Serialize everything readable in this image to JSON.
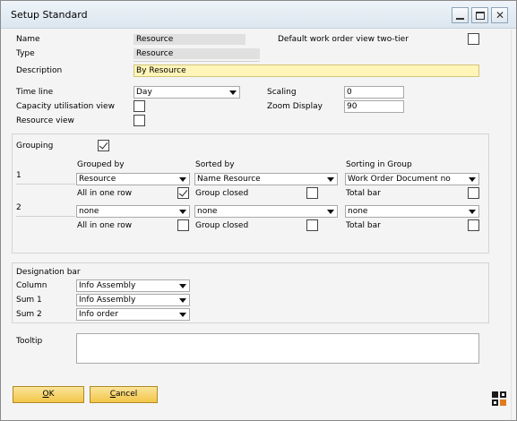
{
  "window": {
    "title": "Setup Standard",
    "controls": {
      "minimize": "minimize",
      "maximize": "maximize",
      "close": "✕"
    }
  },
  "header": {
    "name_label": "Name",
    "name_value": "Resource",
    "type_label": "Type",
    "type_value": "Resource",
    "description_label": "Description",
    "description_value": "By Resource",
    "two_tier_label": "Default work order view two-tier",
    "two_tier_checked": false
  },
  "view": {
    "time_line_label": "Time line",
    "time_line_value": "Day",
    "capacity_label": "Capacity utilisation view",
    "capacity_checked": false,
    "resource_view_label": "Resource view",
    "resource_view_checked": false,
    "scaling_label": "Scaling",
    "scaling_value": "0",
    "zoom_label": "Zoom Display",
    "zoom_value": "90"
  },
  "grouping": {
    "label": "Grouping",
    "checked": true,
    "col_grouped_by": "Grouped by",
    "col_sorted_by": "Sorted by",
    "col_sorting_in_group": "Sorting in Group",
    "rows": [
      {
        "index": "1",
        "grouped_by": "Resource",
        "sorted_by": "Name Resource",
        "sorting_in_group": "Work Order Document no",
        "all_in_one_row_label": "All in one row",
        "all_in_one_row_checked": true,
        "group_closed_label": "Group closed",
        "group_closed_checked": false,
        "total_bar_label": "Total bar",
        "total_bar_checked": false
      },
      {
        "index": "2",
        "grouped_by": "none",
        "sorted_by": "none",
        "sorting_in_group": "none",
        "all_in_one_row_label": "All in one row",
        "all_in_one_row_checked": false,
        "group_closed_label": "Group closed",
        "group_closed_checked": false,
        "total_bar_label": "Total bar",
        "total_bar_checked": false
      }
    ]
  },
  "designation": {
    "label": "Designation bar",
    "column_label": "Column",
    "column_value": "Info Assembly",
    "sum1_label": "Sum 1",
    "sum1_value": "Info Assembly",
    "sum2_label": "Sum 2",
    "sum2_value": "Info order"
  },
  "tooltip": {
    "label": "Tooltip",
    "value": ""
  },
  "buttons": {
    "ok_mnemonic": "O",
    "ok_rest": "K",
    "cancel_mnemonic": "C",
    "cancel_rest": "ancel"
  },
  "colors": {
    "button": "#f2c649",
    "description_field": "#fff5b8",
    "logo_accent": "#e07b1c"
  }
}
